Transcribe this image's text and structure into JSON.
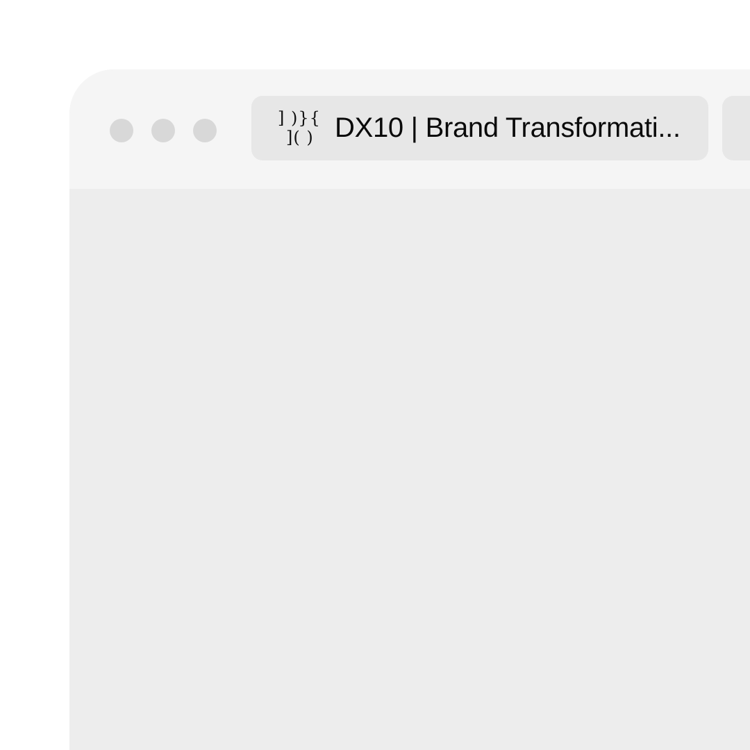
{
  "window": {
    "controls": [
      "close",
      "minimize",
      "zoom"
    ]
  },
  "tabs": [
    {
      "title": "DX10 | Brand Transformati...",
      "favicon_line1": "] )}{",
      "favicon_line2": "]( )",
      "active": true
    },
    {
      "title": "",
      "active": false
    }
  ],
  "colors": {
    "title_bar": "#f5f5f5",
    "content": "#ededed",
    "tab": "#e7e7e7",
    "traffic_light": "#d8d8d8"
  }
}
